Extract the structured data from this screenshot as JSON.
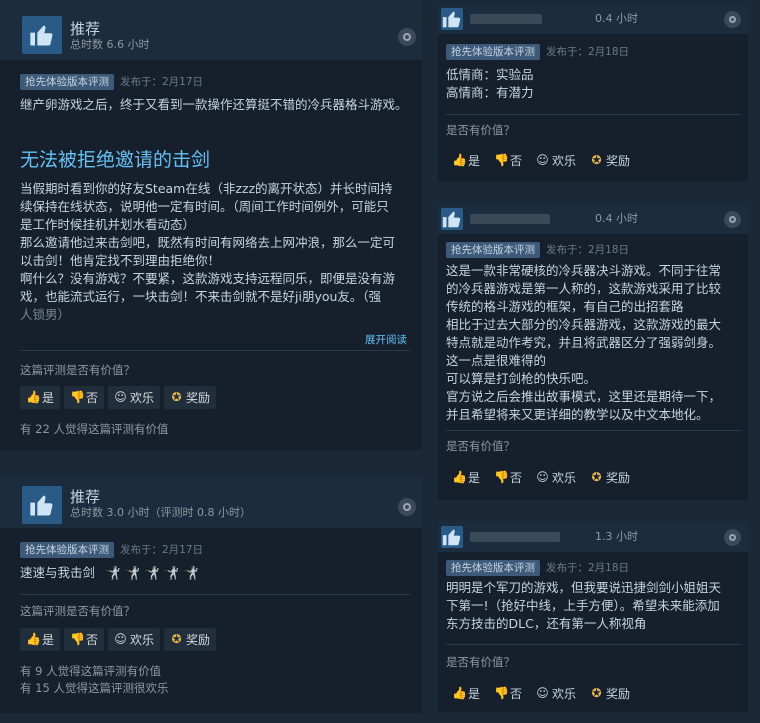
{
  "left1": {
    "verdict": "推荐",
    "hours": "总时数 6.6 小时",
    "tag": "抢先体验版本评测",
    "posted": "发布于：2月17日",
    "intro": "继产卵游戏之后，终于又看到一款操作还算挺不错的冷兵器格斗游戏。",
    "headline": "无法被拒绝邀请的击剑",
    "lines": [
      "当假期时看到你的好友Steam在线（非zzz的离开状态）并长时间持",
      "续保持在线状态，说明他一定有时间。（周间工作时间例外，可能只",
      "是工作时候挂机并划水看动态）",
      "那么邀请他过来击剑吧，既然有时间有网络去上网冲浪，那么一定可",
      "以击剑！他肯定找不到理由拒绝你！",
      "啊什么？没有游戏？不要紧，这款游戏支持远程同乐，即便是没有游",
      "戏，也能流式运行，一块击剑！不来击剑就不是好ji朋you友。（强",
      "人锁男）"
    ],
    "expand": "展开阅读",
    "question": "这篇评测是否有价值？",
    "buttons": [
      "是",
      "否",
      "欢乐",
      "奖励"
    ],
    "stats": [
      "有 22 人觉得这篇评测有价值"
    ]
  },
  "left2": {
    "verdict": "推荐",
    "hours": "总时数 3.0 小时（评测时 0.8 小时）",
    "tag": "抢先体验版本评测",
    "posted": "发布于：2月17日",
    "text": "速速与我击剑",
    "question": "这篇评测是否有价值？",
    "buttons": [
      "是",
      "否",
      "欢乐",
      "奖励"
    ],
    "stats": [
      "有 9 人觉得这篇评测有价值",
      "有 15 人觉得这篇评测很欢乐"
    ]
  },
  "right1": {
    "hours": "0.4 小时",
    "tag": "抢先体验版本评测",
    "posted": "发布于：2月18日",
    "lines": [
      "低情商：实验品",
      "高情商：有潜力"
    ],
    "question": "是否有价值？",
    "buttons": [
      "是",
      "否",
      "欢乐",
      "奖励"
    ]
  },
  "right2": {
    "hours": "0.4 小时",
    "tag": "抢先体验版本评测",
    "posted": "发布于：2月18日",
    "lines": [
      "这是一款非常硬核的冷兵器决斗游戏。不同于往常",
      "的冷兵器游戏是第一人称的，这款游戏采用了比较",
      "传统的格斗游戏的框架，有自己的出招套路",
      "相比于过去大部分的冷兵器游戏，这款游戏的最大",
      "特点就是动作考究，并且将武器区分了强弱剑身。",
      "这一点是很难得的",
      "可以算是打剑枪的快乐吧。",
      "官方说之后会推出故事模式，这里还是期待一下，",
      "并且希望将来又更详细的教学以及中文本地化。"
    ],
    "question": "是否有价值？",
    "buttons": [
      "是",
      "否",
      "欢乐",
      "奖励"
    ]
  },
  "right3": {
    "hours": "1.3 小时",
    "tag": "抢先体验版本评测",
    "posted": "发布于：2月18日",
    "lines": [
      "明明是个军刀的游戏，但我要说迅捷剑剑小姐姐天",
      "下第一!（抢好中线，上手方便）。希望未来能添加",
      "东方技击的DLC，还有第一人称视角"
    ],
    "question": "是否有价值？",
    "buttons": [
      "是",
      "否",
      "欢乐",
      "奖励"
    ]
  }
}
